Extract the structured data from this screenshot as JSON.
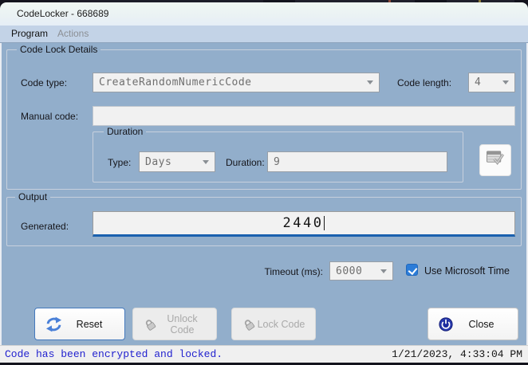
{
  "window": {
    "title": "CodeLocker - 668689"
  },
  "menu": {
    "items": [
      {
        "label": "Program",
        "enabled": true
      },
      {
        "label": "Actions",
        "enabled": false
      }
    ]
  },
  "details": {
    "group_label": "Code Lock Details",
    "code_type": {
      "label": "Code type:",
      "value": "CreateRandomNumericCode"
    },
    "code_length": {
      "label": "Code length:",
      "value": "4"
    },
    "manual_code": {
      "label": "Manual code:",
      "value": "",
      "placeholder": ""
    },
    "duration": {
      "group_label": "Duration",
      "type": {
        "label": "Type:",
        "value": "Days"
      },
      "length": {
        "label": "Duration:",
        "value": "9"
      }
    },
    "validate_button_icon": "window-check-icon"
  },
  "output": {
    "group_label": "Output",
    "generated": {
      "label": "Generated:",
      "value": "2440"
    }
  },
  "settings": {
    "timeout": {
      "label": "Timeout (ms):",
      "value": "6000"
    },
    "use_ms_time": {
      "label": "Use Microsoft Time",
      "checked": true
    }
  },
  "buttons": {
    "reset": {
      "label": "Reset",
      "icon": "sync-icon",
      "enabled": true
    },
    "unlock": {
      "label": "Unlock Code",
      "icon": "padlock-icon",
      "enabled": false
    },
    "lock": {
      "label": "Lock Code",
      "icon": "padlock-icon",
      "enabled": false
    },
    "close": {
      "label": "Close",
      "icon": "power-icon",
      "enabled": true
    }
  },
  "status": {
    "message": "Code has been encrypted and locked.",
    "timestamp": "1/21/2023, 4:33:04 PM"
  },
  "colors": {
    "client_bg": "#92aecb",
    "menubar_bg": "#c3d3e7",
    "focus_blue": "#1a61af",
    "checkbox_blue": "#2b7cd8",
    "status_text_blue": "#2222cf",
    "disabled_text": "#a9a9a9"
  }
}
